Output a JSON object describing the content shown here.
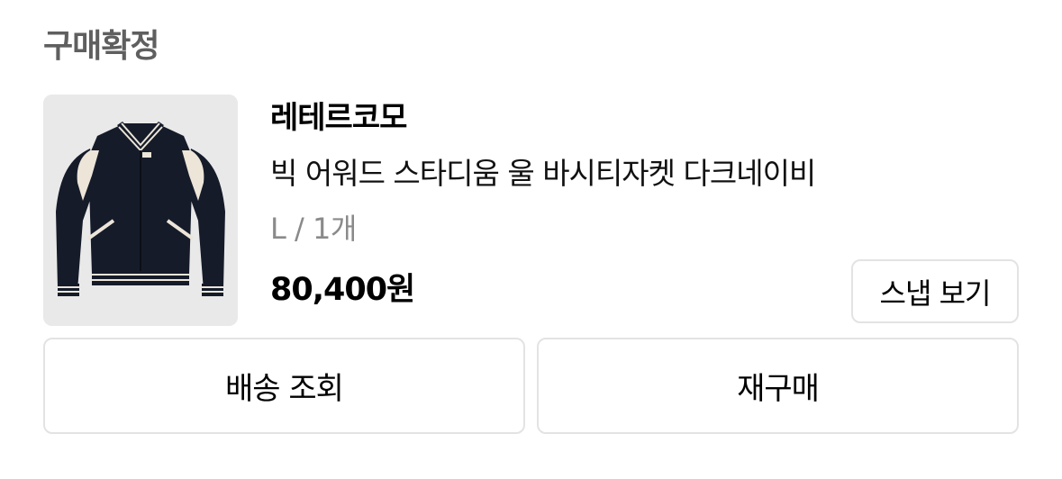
{
  "order": {
    "status_label": "구매확정"
  },
  "product": {
    "image_icon": "varsity-jacket-image",
    "brand": "레테르코모",
    "name": "빅 어워드 스타디움 울 바시티자켓 다크네이비",
    "option": "L / 1개",
    "price": "80,400원"
  },
  "buttons": {
    "snap_label": "스냅 보기",
    "delivery_label": "배송 조회",
    "rebuy_label": "재구매"
  },
  "colors": {
    "jacket_body": "#151b29",
    "jacket_accent": "#ece5d8",
    "thumbnail_bg": "#e9e9e9",
    "border": "#e3e3e3",
    "muted_text": "#8a8a8a"
  }
}
